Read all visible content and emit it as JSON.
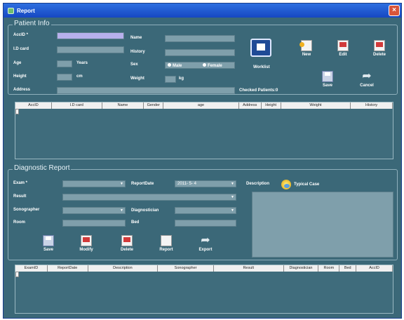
{
  "window": {
    "title": "Report"
  },
  "patient": {
    "group_title": "Patient Info",
    "labels": {
      "accid": "AccID *",
      "id_card": "I.D card",
      "age": "Age",
      "height": "Height",
      "address": "Address",
      "name": "Name",
      "history": "History",
      "sex": "Sex",
      "weight": "Weight"
    },
    "units": {
      "age": "Years",
      "height": "cm",
      "weight": "kg"
    },
    "sex_options": [
      "Male",
      "Female"
    ],
    "worklist_label": "Worklist",
    "checked_label": "Checked Patients:0",
    "toolbar": {
      "new": "New",
      "edit": "Edit",
      "delete": "Delete",
      "save": "Save",
      "cancel": "Cancel"
    },
    "columns": [
      "AccID",
      "I.D card",
      "Name",
      "Gender",
      "age",
      "Address",
      "Height",
      "Weight",
      "History"
    ]
  },
  "report": {
    "group_title": "Diagnostic Report",
    "labels": {
      "exam": "Exam *",
      "result": "Result",
      "sonographer": "Sonographer",
      "room": "Room",
      "report_date": "ReportDate",
      "diagnostician": "Diagnostician",
      "bed": "Bed",
      "description": "Description",
      "typical_case": "Typical Case"
    },
    "report_date_value": "2011- 5- 4",
    "toolbar": {
      "save": "Save",
      "modify": "Modify",
      "delete": "Delete",
      "report": "Report",
      "export": "Export"
    },
    "columns": [
      "ExamID",
      "ReportDate",
      "Description",
      "Sonographer",
      "Result",
      "Diagnostician",
      "Room",
      "Bed",
      "AccID"
    ]
  },
  "icons": [
    "app-icon",
    "close-icon",
    "worklist-icon",
    "new-icon",
    "edit-icon",
    "delete-icon",
    "save-icon",
    "cancel-icon",
    "typical-case-icon",
    "modify-icon",
    "report-icon",
    "export-icon"
  ],
  "colors": {
    "window_bg": "#3b6878",
    "field_bg": "#7f9fab",
    "highlight_field": "#b7b0ec",
    "titlebar": "#1647c2"
  }
}
